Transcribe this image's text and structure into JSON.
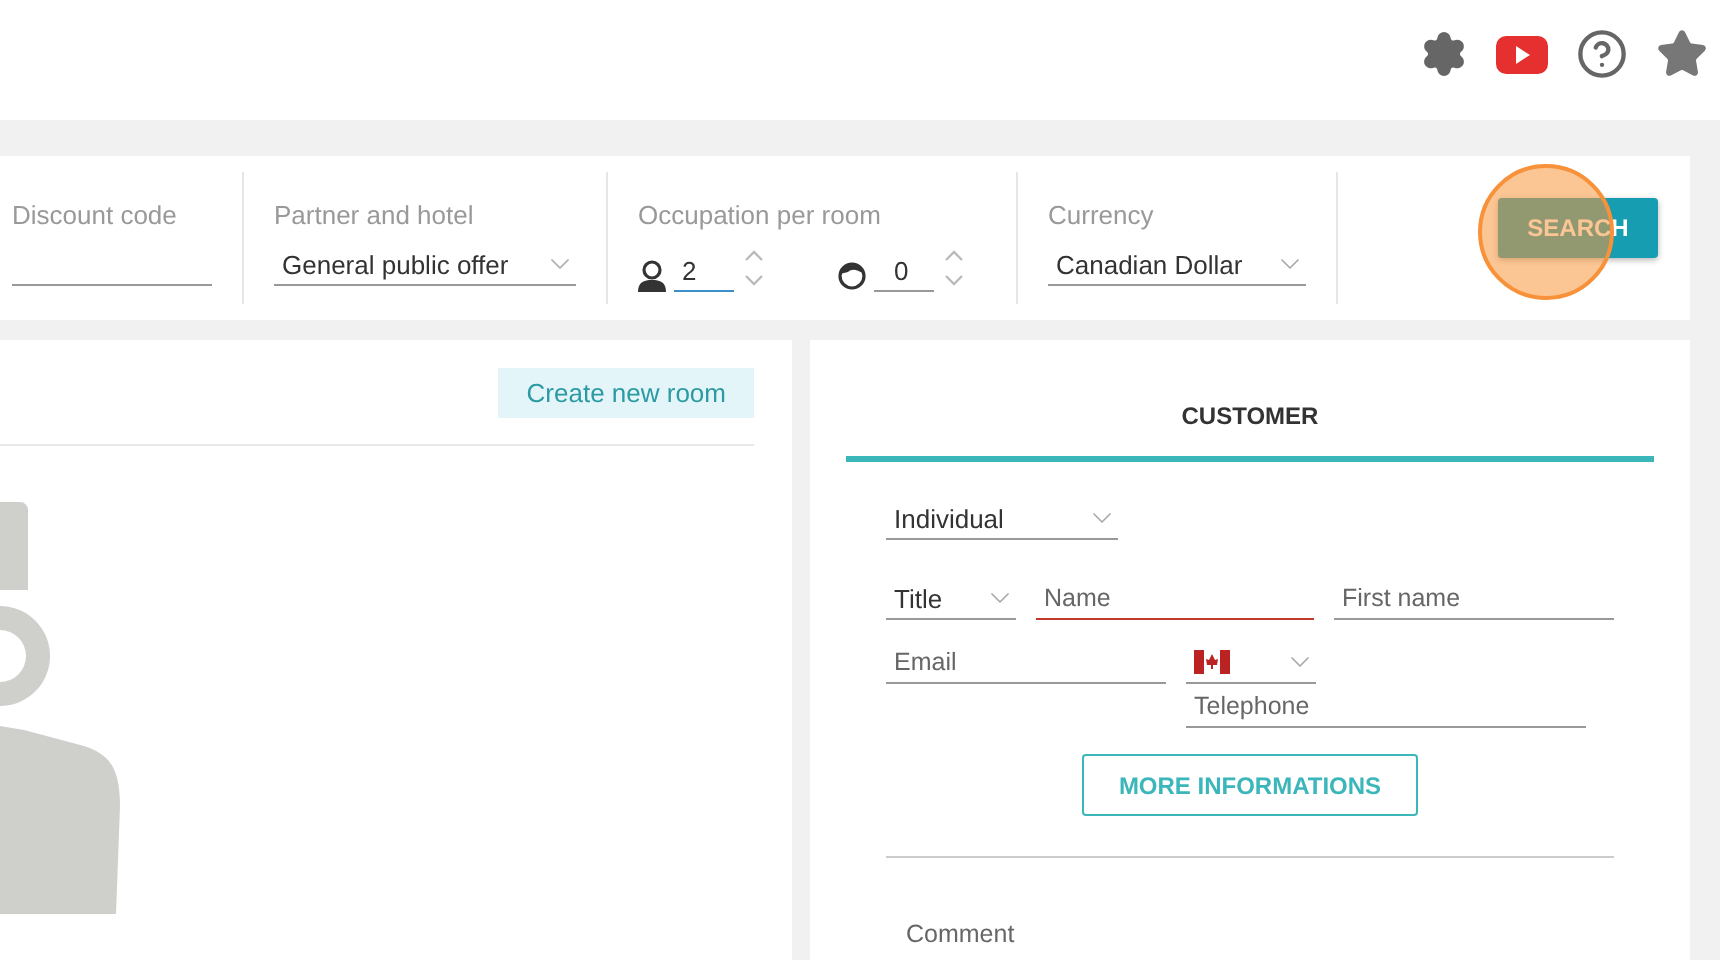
{
  "search_bar": {
    "fields": [
      {
        "kind": "text",
        "label": "Discount code"
      },
      {
        "kind": "select",
        "label": "Partner and hotel",
        "value": "General public offer"
      },
      {
        "kind": "occupation",
        "label": "Occupation per room",
        "adults": {
          "value": "2",
          "focused": true
        },
        "children": {
          "value": "0",
          "focused": false
        }
      },
      {
        "kind": "select",
        "label": "Currency",
        "value": "Canadian Dollar"
      }
    ],
    "button": "SEARCH"
  },
  "rooms": {
    "create_button": "Create new room"
  },
  "customer": {
    "title": "CUSTOMER",
    "type": "Individual",
    "title_select": "Title",
    "name": {
      "placeholder": "Name",
      "invalid": true
    },
    "first_name": {
      "placeholder": "First name",
      "invalid": false
    },
    "email": {
      "placeholder": "Email"
    },
    "telephone": {
      "placeholder": "Telephone"
    },
    "more_button": "MORE INFORMATIONS",
    "comment": {
      "placeholder": "Comment"
    }
  }
}
